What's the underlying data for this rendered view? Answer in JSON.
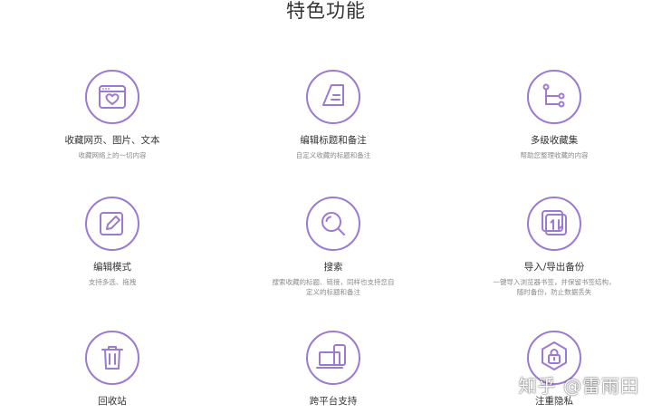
{
  "page": {
    "title": "特色功能"
  },
  "features": [
    {
      "title": "收藏网页、图片、文本",
      "desc": [
        "收藏网络上的一切内容"
      ],
      "icon": "browser-heart-icon"
    },
    {
      "title": "编辑标题和备注",
      "desc": [
        "自定义收藏的标题和备注"
      ],
      "icon": "edit-note-icon"
    },
    {
      "title": "多级收藏集",
      "desc": [
        "帮助您整理收藏的内容"
      ],
      "icon": "tree-icon"
    },
    {
      "title": "编辑模式",
      "desc": [
        "支持多选、拖拽"
      ],
      "icon": "pencil-icon"
    },
    {
      "title": "搜索",
      "desc": [
        "搜索收藏的标题、链接，同样也支持您自",
        "定义的标题和备注"
      ],
      "icon": "search-icon"
    },
    {
      "title": "导入/导出备份",
      "desc": [
        "一键导入浏览器书签，并保留书签结构，",
        "随时备份，防止数据丢失"
      ],
      "icon": "import-export-icon"
    },
    {
      "title": "回收站",
      "desc": [],
      "icon": "trash-icon"
    },
    {
      "title": "跨平台支持",
      "desc": [],
      "icon": "devices-icon"
    },
    {
      "title": "注重隐私",
      "desc": [],
      "icon": "privacy-lock-icon"
    }
  ],
  "watermark": "知乎 @雷雨田",
  "colors": {
    "accent": "#9b7ad6",
    "title": "#333333",
    "desc": "#8a8a8a"
  }
}
